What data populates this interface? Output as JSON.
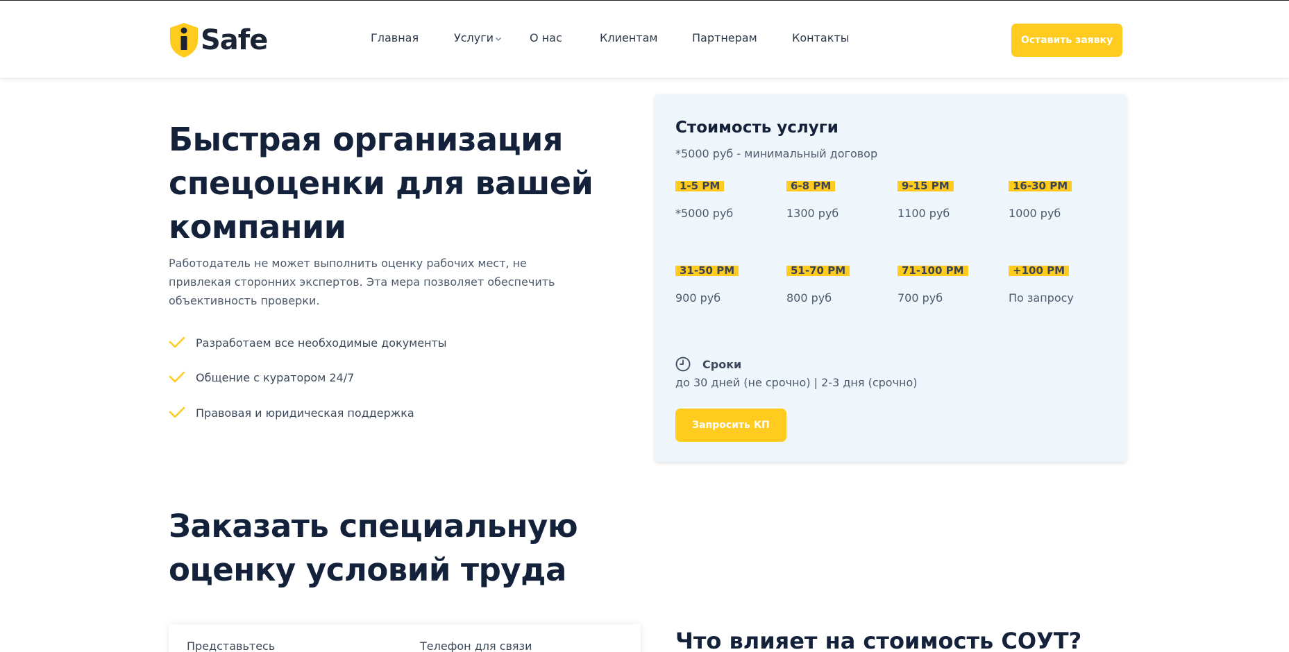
{
  "brand": {
    "name": "Safe",
    "accent": "#ffcb1f",
    "dark": "#13213a"
  },
  "nav": {
    "items": [
      {
        "label": "Главная"
      },
      {
        "label": "Услуги",
        "has_dropdown": true
      },
      {
        "label": "О нас"
      },
      {
        "label": "Клиентам"
      },
      {
        "label": "Партнерам"
      },
      {
        "label": "Контакты"
      }
    ],
    "cta_label": "Оставить заявку"
  },
  "hero": {
    "title": "Быстрая организация спецоценки для вашей компании",
    "description": "Работодатель не может выполнить оценку рабочих мест, не привлекая сторонних экспертов. Эта мера позволяет обеспечить объективность проверки.",
    "features": [
      "Разработаем все необходимые документы",
      "Общение с куратором 24/7",
      "Правовая и юридическая поддержка"
    ]
  },
  "pricing": {
    "title": "Стоимость услуги",
    "subtitle": "*5000 руб - минимальный договор",
    "tiers": [
      {
        "range": "1-5 РМ",
        "price": "*5000 руб"
      },
      {
        "range": "6-8 РМ",
        "price": "1300 руб"
      },
      {
        "range": "9-15 РМ",
        "price": "1100 руб"
      },
      {
        "range": "16-30 РМ",
        "price": "1000 руб"
      },
      {
        "range": "31-50 РМ",
        "price": "900 руб"
      },
      {
        "range": "51-70 РМ",
        "price": "800 руб"
      },
      {
        "range": "71-100 РМ",
        "price": "700 руб"
      },
      {
        "range": "+100 РМ",
        "price": "По запросу"
      }
    ],
    "terms_label": "Сроки",
    "terms_text": "до 30 дней (не срочно) | 2-3 дня (срочно)",
    "cta_label": "Запросить КП",
    "icons": {
      "terms": "clock-icon"
    }
  },
  "order": {
    "title": "Заказать специальную оценку условий труда",
    "form": {
      "name_label": "Представьтесь",
      "phone_label": "Телефон для связи"
    }
  },
  "cost_factors": {
    "title": "Что влияет на стоимость СОУТ?"
  }
}
